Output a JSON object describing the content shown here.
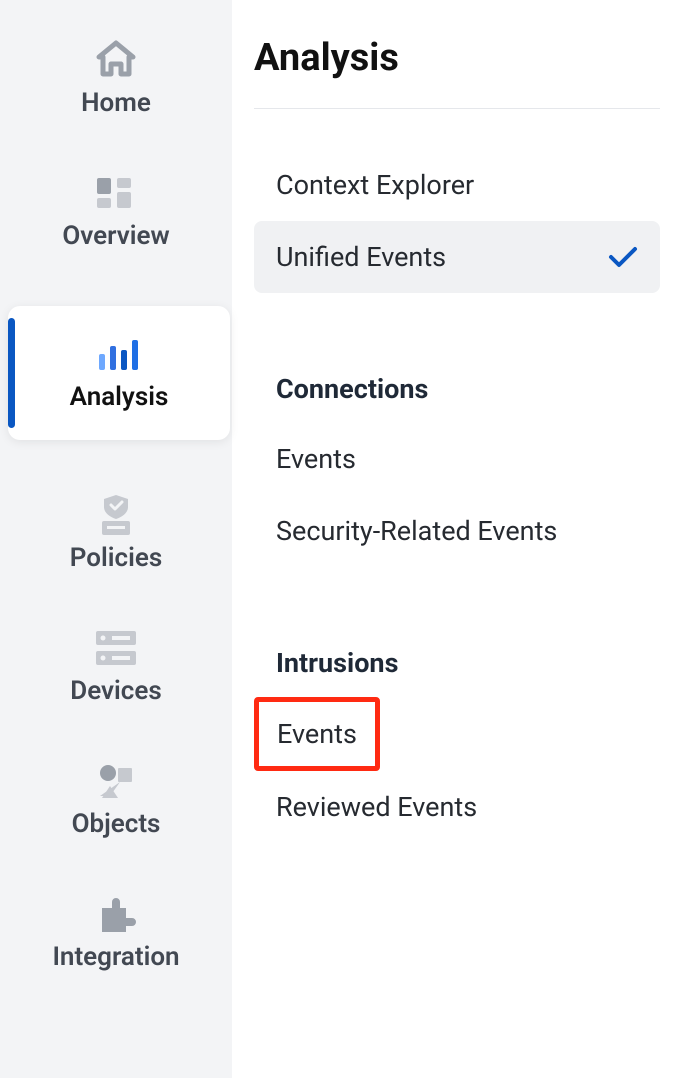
{
  "sidebar": {
    "items": [
      {
        "label": "Home"
      },
      {
        "label": "Overview"
      },
      {
        "label": "Analysis"
      },
      {
        "label": "Policies"
      },
      {
        "label": "Devices"
      },
      {
        "label": "Objects"
      },
      {
        "label": "Integration"
      }
    ]
  },
  "content": {
    "title": "Analysis",
    "top_items": [
      {
        "label": "Context Explorer"
      },
      {
        "label": "Unified Events"
      }
    ],
    "sections": [
      {
        "title": "Connections",
        "items": [
          {
            "label": "Events"
          },
          {
            "label": "Security-Related Events"
          }
        ]
      },
      {
        "title": "Intrusions",
        "items": [
          {
            "label": "Events"
          },
          {
            "label": "Reviewed Events"
          }
        ]
      }
    ]
  }
}
